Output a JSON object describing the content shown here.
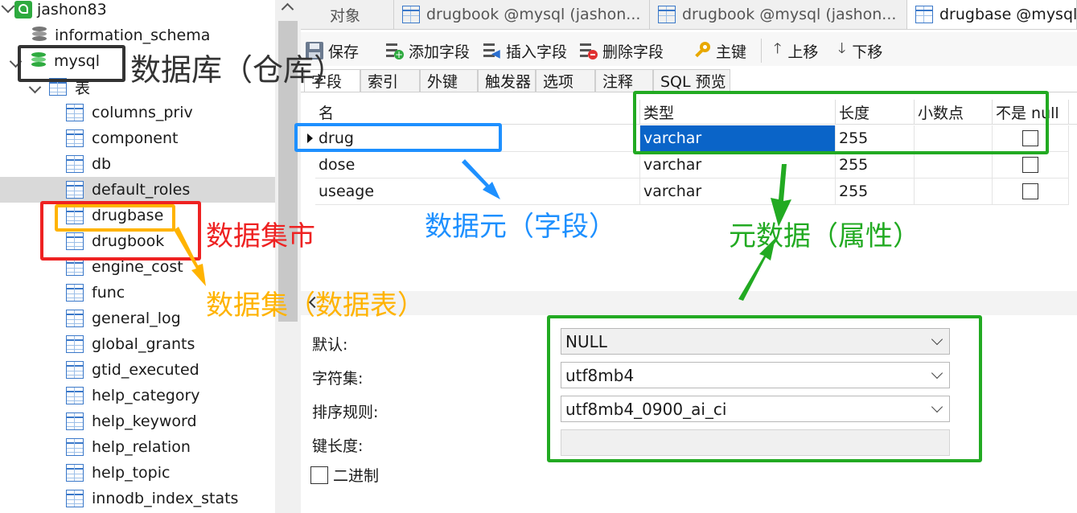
{
  "tree": {
    "connection": "jashon83",
    "databases": [
      {
        "name": "information_schema"
      },
      {
        "name": "mysql"
      }
    ],
    "tables_group": "表",
    "tables": [
      "columns_priv",
      "component",
      "db",
      "default_roles",
      "drugbase",
      "drugbook",
      "engine_cost",
      "func",
      "general_log",
      "global_grants",
      "gtid_executed",
      "help_category",
      "help_keyword",
      "help_relation",
      "help_topic",
      "innodb_index_stats"
    ],
    "selected_table": "default_roles"
  },
  "tabs": [
    {
      "label": "对象"
    },
    {
      "label": "drugbook @mysql (jashon..."
    },
    {
      "label": "drugbook @mysql (jashon..."
    },
    {
      "label": "drugbase @mysql"
    }
  ],
  "toolbar": {
    "save": "保存",
    "add_field": "添加字段",
    "insert_field": "插入字段",
    "delete_field": "删除字段",
    "primary_key": "主键",
    "move_up": "上移",
    "move_down": "下移"
  },
  "sub_tabs": [
    "字段",
    "索引",
    "外键",
    "触发器",
    "选项",
    "注释",
    "SQL 预览"
  ],
  "grid": {
    "headers": {
      "name": "名",
      "type": "类型",
      "length": "长度",
      "decimals": "小数点",
      "not_null": "不是 null"
    },
    "rows": [
      {
        "name": "drug",
        "type": "varchar",
        "length": "255",
        "decimals": "",
        "not_null": false
      },
      {
        "name": "dose",
        "type": "varchar",
        "length": "255",
        "decimals": "",
        "not_null": false
      },
      {
        "name": "useage",
        "type": "varchar",
        "length": "255",
        "decimals": "",
        "not_null": false
      }
    ]
  },
  "props": {
    "default_label": "默认:",
    "default_value": "NULL",
    "charset_label": "字符集:",
    "charset_value": "utf8mb4",
    "collation_label": "排序规则:",
    "collation_value": "utf8mb4_0900_ai_ci",
    "key_length_label": "键长度:",
    "key_length_value": "",
    "binary_label": "二进制",
    "binary_checked": false
  },
  "annotations": {
    "warehouse": "数据库（仓库）",
    "datamart": "数据集市",
    "dataset": "数据集（数据表）",
    "data_element": "数据元（字段）",
    "metadata": "元数据（属性）"
  },
  "colors": {
    "annotation_black": "#333333",
    "annotation_red": "#ee2222",
    "annotation_orange": "#ffb300",
    "annotation_blue": "#1e90ff",
    "annotation_green": "#22aa22",
    "selection_blue": "#0a64c8"
  }
}
